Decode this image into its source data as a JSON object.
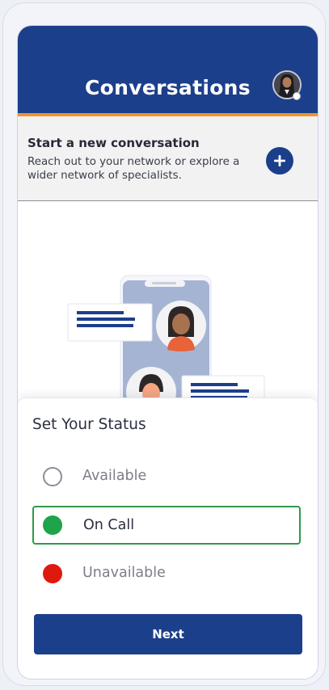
{
  "header": {
    "title": "Conversations",
    "avatar_icon": "user-avatar-icon",
    "avatar_status": "available"
  },
  "new_conversation": {
    "title": "Start a new conversation",
    "description": "Reach out to your network or explore a wider network of specialists.",
    "add_icon": "plus-icon"
  },
  "illustration": {
    "icon": "chat-conversation-illustration"
  },
  "status_sheet": {
    "title": "Set Your Status",
    "options": [
      {
        "label": "Available",
        "color": "#ffffff",
        "selected": false
      },
      {
        "label": "On Call",
        "color": "#1ea44a",
        "selected": true
      },
      {
        "label": "Unavailable",
        "color": "#e0190f",
        "selected": false
      }
    ],
    "next_label": "Next"
  },
  "colors": {
    "brand_blue": "#1c3f8c",
    "accent_orange": "#f0952a",
    "selected_border": "#2f9a4a"
  }
}
